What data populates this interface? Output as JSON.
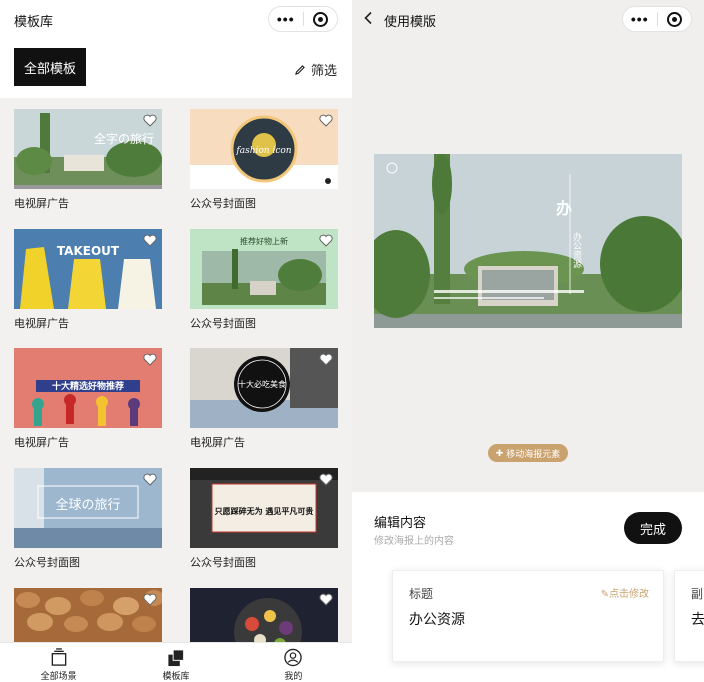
{
  "left": {
    "title": "模板库",
    "all_templates_label": "全部模板",
    "filter_label": "筛选",
    "cards": [
      {
        "label": "电视屏广告",
        "thumb_text": "全字の旅行"
      },
      {
        "label": "公众号封面图",
        "thumb_text": "fashion icon"
      },
      {
        "label": "电视屏广告",
        "thumb_text": "TAKEOUT"
      },
      {
        "label": "公众号封面图",
        "thumb_text": "推荐好物上新"
      },
      {
        "label": "电视屏广告",
        "thumb_text": "十大精选好物推荐"
      },
      {
        "label": "电视屏广告",
        "thumb_text": "十大必吃美食"
      },
      {
        "label": "公众号封面图",
        "thumb_text": "全球の旅行"
      },
      {
        "label": "公众号封面图",
        "thumb_text": "只愿踩碎无为 遇见平凡可贵"
      },
      {
        "label": "",
        "thumb_text": ""
      },
      {
        "label": "",
        "thumb_text": ""
      }
    ],
    "tabs": [
      {
        "label": "全部场景",
        "icon": "stack-icon"
      },
      {
        "label": "模板库",
        "icon": "template-library-icon"
      },
      {
        "label": "我的",
        "icon": "user-icon"
      }
    ]
  },
  "right": {
    "title": "使用模版",
    "poster_text": "办公资源",
    "move_label": "移动海报元素",
    "editor_title": "编辑内容",
    "editor_subtitle": "修改海报上的内容",
    "done_label": "完成",
    "fields": [
      {
        "label": "标题",
        "edit_label": "点击修改",
        "value": "办公资源"
      },
      {
        "label": "副",
        "value": "去"
      }
    ]
  },
  "colors": {
    "accent_gold": "#c9a26d",
    "dark": "#111111",
    "panel_bg": "#f3f1ef"
  }
}
